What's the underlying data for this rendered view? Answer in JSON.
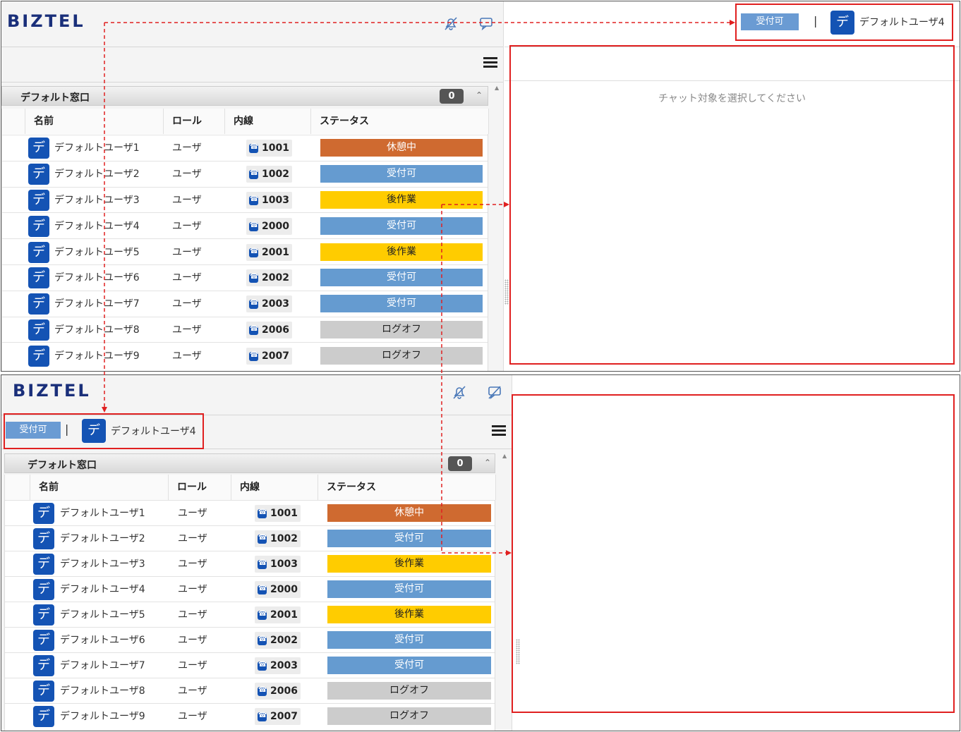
{
  "brand": "BIZTEL",
  "group": {
    "title": "デフォルト窓口",
    "count": "0"
  },
  "columns": [
    "名前",
    "ロール",
    "内線",
    "ステータス"
  ],
  "rows": [
    {
      "avatar": "デ",
      "name": "デフォルトユーザ1",
      "role": "ユーザ",
      "ext": "1001",
      "status": "休憩中",
      "kind": "rest"
    },
    {
      "avatar": "デ",
      "name": "デフォルトユーザ2",
      "role": "ユーザ",
      "ext": "1002",
      "status": "受付可",
      "kind": "avail"
    },
    {
      "avatar": "デ",
      "name": "デフォルトユーザ3",
      "role": "ユーザ",
      "ext": "1003",
      "status": "後作業",
      "kind": "after"
    },
    {
      "avatar": "デ",
      "name": "デフォルトユーザ4",
      "role": "ユーザ",
      "ext": "2000",
      "status": "受付可",
      "kind": "avail"
    },
    {
      "avatar": "デ",
      "name": "デフォルトユーザ5",
      "role": "ユーザ",
      "ext": "2001",
      "status": "後作業",
      "kind": "after"
    },
    {
      "avatar": "デ",
      "name": "デフォルトユーザ6",
      "role": "ユーザ",
      "ext": "2002",
      "status": "受付可",
      "kind": "avail"
    },
    {
      "avatar": "デ",
      "name": "デフォルトユーザ7",
      "role": "ユーザ",
      "ext": "2003",
      "status": "受付可",
      "kind": "avail"
    },
    {
      "avatar": "デ",
      "name": "デフォルトユーザ8",
      "role": "ユーザ",
      "ext": "2006",
      "status": "ログオフ",
      "kind": "off"
    },
    {
      "avatar": "デ",
      "name": "デフォルトユーザ9",
      "role": "ユーザ",
      "ext": "2007",
      "status": "ログオフ",
      "kind": "off"
    }
  ],
  "current_user": {
    "status": "受付可",
    "separator": "|",
    "avatar": "デ",
    "name": "デフォルトユーザ4"
  },
  "chat": {
    "placeholder": "チャット対象を選択してください"
  },
  "icons": {
    "notify": "bell-off-icon",
    "chat": "chat-off-icon",
    "menu": "hamburger-menu-icon",
    "collapse": "double-chevron-up-icon",
    "phone": "phone-icon"
  },
  "colors": {
    "rest": "#cf6a30",
    "avail": "#659bd0",
    "after": "#ffcc00",
    "off": "#cccccc",
    "avatar": "#1453b4",
    "annotation": "#e02020"
  }
}
